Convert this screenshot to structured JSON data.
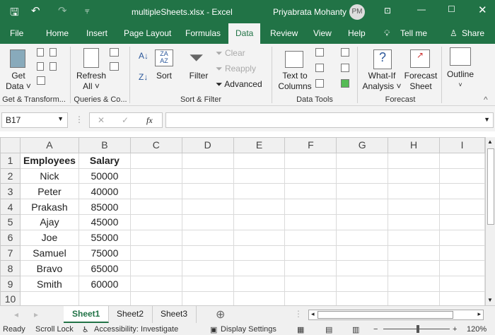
{
  "title_bar": {
    "filename": "multipleSheets.xlsx",
    "sep": "-",
    "app": "Excel",
    "user": "Priyabrata Mohanty",
    "initials": "PM"
  },
  "tabs": [
    "File",
    "Home",
    "Insert",
    "Page Layout",
    "Formulas",
    "Data",
    "Review",
    "View",
    "Help",
    "Tell me",
    "Share"
  ],
  "ribbon": {
    "get_data": "Get",
    "get_data2": "Data ˅",
    "refresh": "Refresh",
    "refresh2": "All ˅",
    "sort": "Sort",
    "filter": "Filter",
    "clear": "Clear",
    "reapply": "Reapply",
    "advanced": "Advanced",
    "text_to": "Text to",
    "columns": "Columns",
    "whatif": "What-If",
    "analysis": "Analysis ˅",
    "forecast": "Forecast",
    "sheet": "Sheet",
    "outline": "Outline",
    "groups": [
      "Get & Transform...",
      "Queries & Co...",
      "Sort & Filter",
      "Data Tools",
      "Forecast"
    ]
  },
  "formula_bar": {
    "name_box": "B17",
    "fx": "fx",
    "value": ""
  },
  "columns": [
    "A",
    "B",
    "C",
    "D",
    "E",
    "F",
    "G",
    "H",
    "I"
  ],
  "rows": [
    [
      "Employees",
      "Salary"
    ],
    [
      "Nick",
      "50000"
    ],
    [
      "Peter",
      "40000"
    ],
    [
      "Prakash",
      "85000"
    ],
    [
      "Ajay",
      "45000"
    ],
    [
      "Joe",
      "55000"
    ],
    [
      "Samuel",
      "75000"
    ],
    [
      "Bravo",
      "65000"
    ],
    [
      "Smith",
      "60000"
    ],
    [
      "",
      ""
    ]
  ],
  "sheets": [
    "Sheet1",
    "Sheet2",
    "Sheet3"
  ],
  "status": {
    "ready": "Ready",
    "scroll_lock": "Scroll Lock",
    "accessibility": "Accessibility: Investigate",
    "display": "Display Settings",
    "zoom": "120%"
  },
  "colors": {
    "accent": "#217346"
  }
}
